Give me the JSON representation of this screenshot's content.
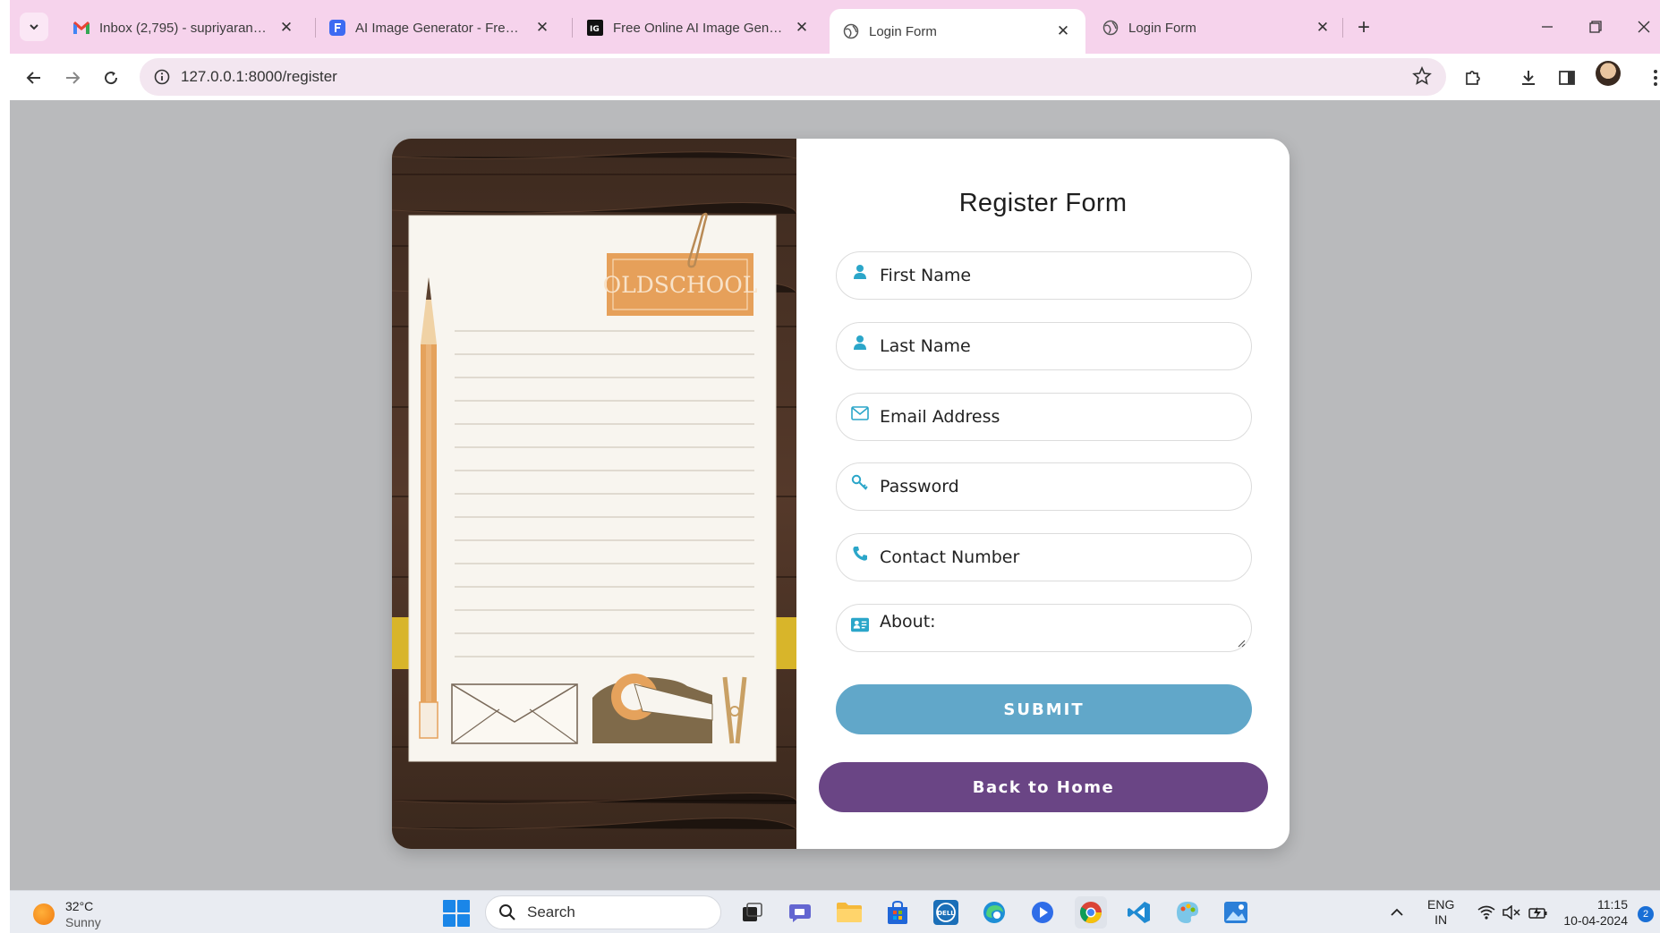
{
  "browser": {
    "tabs": [
      {
        "title": "Inbox (2,795) - supriyarangan7",
        "icon": "gmail-icon",
        "active": false
      },
      {
        "title": "AI Image Generator - Free Text",
        "icon": "f-logo-icon",
        "active": false
      },
      {
        "title": "Free Online AI Image Generator",
        "icon": "ig-logo-icon",
        "active": false
      },
      {
        "title": "Login Form",
        "icon": "globe-icon",
        "active": true
      },
      {
        "title": "Login Form",
        "icon": "globe-icon",
        "active": false
      }
    ],
    "address": "127.0.0.1:8000/register"
  },
  "illustration": {
    "badge_text": "OLDSCHOOL"
  },
  "form": {
    "title": "Register Form",
    "first_name_placeholder": "First Name",
    "last_name_placeholder": "Last Name",
    "email_placeholder": "Email Address",
    "password_placeholder": "Password",
    "contact_placeholder": "Contact Number",
    "about_placeholder": "About:",
    "submit_label": "SUBMIT",
    "home_label": "Back to Home"
  },
  "colors": {
    "accent_icon": "#2ba6c9",
    "submit_bg": "#61a7c9",
    "home_bg": "#6a4585",
    "tabstrip_bg": "#f6d3ec",
    "page_bg": "#b9babc"
  },
  "taskbar": {
    "temperature": "32°C",
    "condition": "Sunny",
    "search_label": "Search",
    "language_line1": "ENG",
    "language_line2": "IN",
    "time": "11:15",
    "date": "10-04-2024",
    "notification_count": "2"
  }
}
